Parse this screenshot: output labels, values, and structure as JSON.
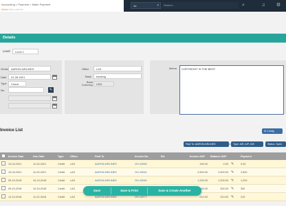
{
  "topbar": {
    "search_value": "All",
    "search_placeholder": "Search...",
    "crumb": "Accounting > Payment > Make Payment",
    "subnav": "Action",
    "subnav2": "More actions"
  },
  "header": {
    "title": "Details"
  },
  "level": {
    "label": "Level",
    "value": "Level 1"
  },
  "form": {
    "vendor_label": "Vendor",
    "vendor_value": "AARON AIRLINES",
    "date_label": "Date",
    "date_value": "01-28-2021",
    "type_label": "Type",
    "type_value": "Check",
    "check_no_label": "No.",
    "office_label": "Office",
    "office_value": "LAX",
    "bank_label": "Bank",
    "bank_value": "banking",
    "bank_currency_label": "Bank Currency",
    "bank_currency_value": "USD",
    "memo_label": "Memo",
    "memo_value": "COPYRIGHT IS THE BEST"
  },
  "section": {
    "title": "Invoice List"
  },
  "config_label": "Config",
  "filter": {
    "label": "Filtered by",
    "chips": [
      "Paid To: AARON AIRLINES",
      "Type: A/R, A/P, G/E",
      "Status: Open"
    ]
  },
  "table": {
    "headers": [
      "",
      "Invoice Date",
      "Due Date",
      "Type",
      "Office",
      "Paid To",
      "Invoice No.",
      "B/L",
      "Invoice AMT",
      "Balance AMT",
      "",
      "Payment"
    ],
    "rows": [
      [
        "10-04-2021",
        "11-03-2021",
        "Credit",
        "LAX",
        "AARON AIRLINES",
        "OH-10098",
        "",
        "160.00",
        "0.00",
        "0.00"
      ],
      [
        "10-04-2021",
        "11-03-2021",
        "Credit",
        "LAX",
        "AARON AIRLINES",
        "OH-10044",
        "",
        "2,500.00",
        "2,500.00",
        "2,500"
      ],
      [
        "09-10-2018",
        "10-10-2018",
        "Credit",
        "LAX",
        "AARON AIRLINES",
        "OH-10049",
        "",
        "1,200.00",
        "1,200.00",
        "1,200"
      ],
      [
        "09-10-2018",
        "10-10-2018",
        "Credit",
        "LAX",
        "AARON AIRLINES",
        "OH-10050",
        "",
        "300.00",
        "300.00",
        "300"
      ],
      [
        "12-10-2018",
        "11-22-2018",
        "Credit",
        "LAX",
        "AARON AIRLINES",
        "OH-10077",
        "",
        "210.00",
        "210.00",
        "210"
      ]
    ]
  },
  "actions": {
    "save": "Save",
    "save_print": "Save & Print",
    "save_create": "Save & Create Another"
  }
}
